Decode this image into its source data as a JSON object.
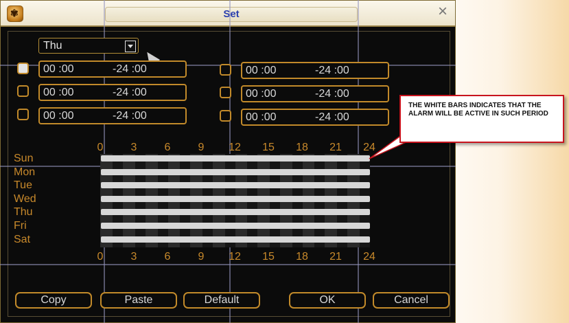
{
  "window": {
    "title": "Set"
  },
  "day_select": {
    "value": "Thu"
  },
  "periods": [
    {
      "checked": true,
      "start": "00 :00",
      "end": "-24 :00"
    },
    {
      "checked": false,
      "start": "00 :00",
      "end": "-24 :00"
    },
    {
      "checked": false,
      "start": "00 :00",
      "end": "-24 :00"
    },
    {
      "checked": false,
      "start": "00 :00",
      "end": "-24 :00"
    },
    {
      "checked": false,
      "start": "00 :00",
      "end": "-24 :00"
    },
    {
      "checked": false,
      "start": "00 :00",
      "end": "-24 :00"
    }
  ],
  "timeline": {
    "hours": [
      "0",
      "3",
      "6",
      "9",
      "12",
      "15",
      "18",
      "21",
      "24"
    ],
    "days": [
      "Sun",
      "Mon",
      "Tue",
      "Wed",
      "Thu",
      "Fri",
      "Sat"
    ]
  },
  "buttons": {
    "copy": "Copy",
    "paste": "Paste",
    "default": "Default",
    "ok": "OK",
    "cancel": "Cancel"
  },
  "callout": {
    "text": "THE WHITE BARS INDICATES THAT THE ALARM WILL BE ACTIVE IN SUCH PERIOD"
  },
  "colors": {
    "accent": "#c28a2a",
    "title": "#2a3fae",
    "callout_border": "#c8141e"
  },
  "icons": {
    "app": "app-logo-icon",
    "close": "close-icon",
    "dropdown": "chevron-down-icon",
    "cursor": "mouse-pointer-icon"
  }
}
